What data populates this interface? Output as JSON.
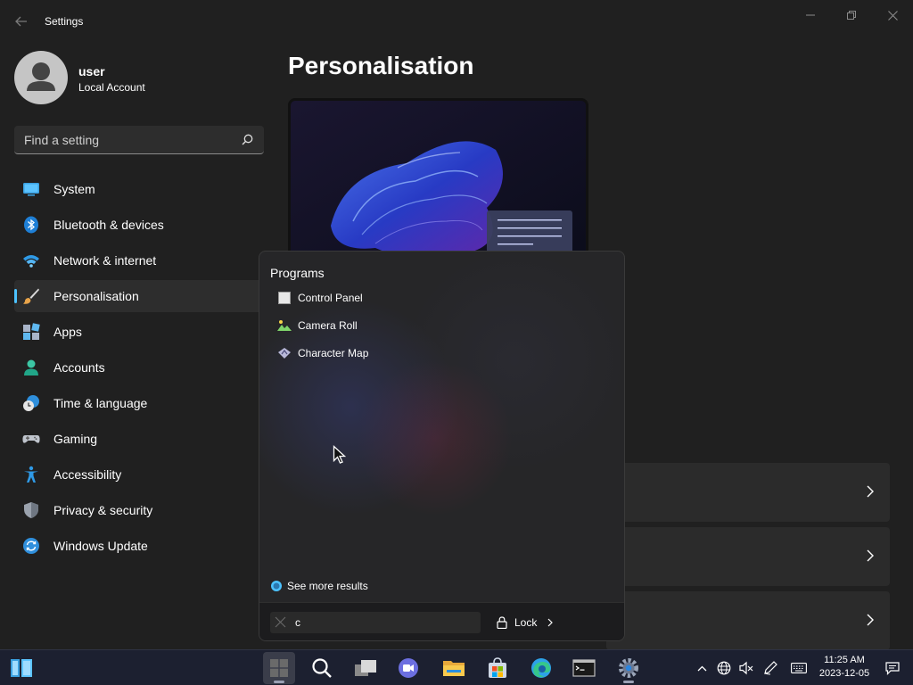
{
  "window": {
    "title": "Settings"
  },
  "user": {
    "name": "user",
    "account_type": "Local Account"
  },
  "search": {
    "placeholder": "Find a setting"
  },
  "sidebar": {
    "items": [
      {
        "label": "System",
        "icon": "monitor-icon",
        "active": false
      },
      {
        "label": "Bluetooth & devices",
        "icon": "bluetooth-icon",
        "active": false
      },
      {
        "label": "Network & internet",
        "icon": "wifi-icon",
        "active": false
      },
      {
        "label": "Personalisation",
        "icon": "paintbrush-icon",
        "active": true
      },
      {
        "label": "Apps",
        "icon": "apps-icon",
        "active": false
      },
      {
        "label": "Accounts",
        "icon": "person-icon",
        "active": false
      },
      {
        "label": "Time & language",
        "icon": "globe-clock-icon",
        "active": false
      },
      {
        "label": "Gaming",
        "icon": "gamepad-icon",
        "active": false
      },
      {
        "label": "Accessibility",
        "icon": "accessibility-icon",
        "active": false
      },
      {
        "label": "Privacy & security",
        "icon": "shield-icon",
        "active": false
      },
      {
        "label": "Windows Update",
        "icon": "sync-icon",
        "active": false
      }
    ]
  },
  "main": {
    "title": "Personalisation"
  },
  "start_menu": {
    "heading": "Programs",
    "programs": [
      {
        "label": "Control Panel",
        "icon": "control-panel-icon"
      },
      {
        "label": "Camera Roll",
        "icon": "photo-icon"
      },
      {
        "label": "Character Map",
        "icon": "character-map-icon"
      }
    ],
    "see_more": "See more results",
    "search_value": "c",
    "lock_label": "Lock"
  },
  "taskbar": {
    "time": "11:25 AM",
    "date": "2023-12-05"
  },
  "colors": {
    "accent": "#4cc2ff",
    "background": "#202020",
    "sidebar_active": "#2d2d2d"
  }
}
